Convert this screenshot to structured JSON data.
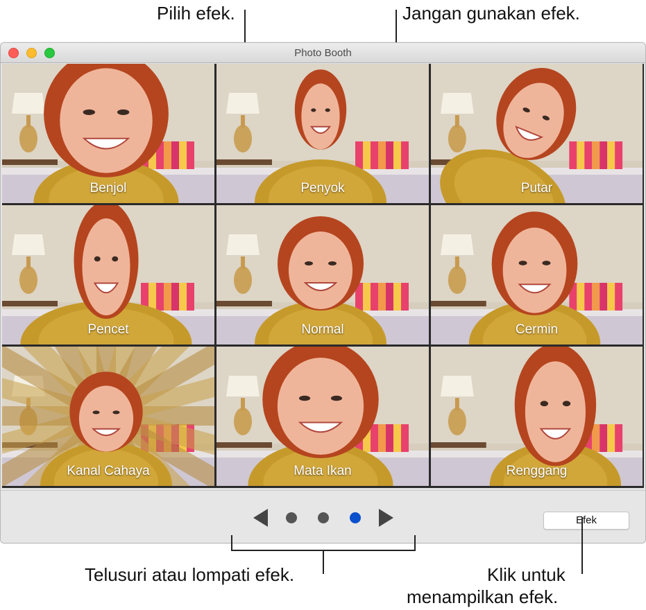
{
  "callouts": {
    "choose_effect": "Pilih efek.",
    "no_effect": "Jangan gunakan efek.",
    "browse": "Telusuri atau lompati efek.",
    "click_line1": "Klik untuk",
    "click_line2": "menampilkan efek."
  },
  "window": {
    "title": "Photo Booth",
    "effects": [
      "Benjol",
      "Penyok",
      "Putar",
      "Pencet",
      "Normal",
      "Cermin",
      "Kanal Cahaya",
      "Mata Ikan",
      "Renggang"
    ],
    "effects_button": "Efek",
    "active_page": 3,
    "page_count": 3
  },
  "colors": {
    "close": "#ff5f57",
    "minimize": "#febc2e",
    "zoom": "#28c840",
    "dot_active": "#0a4fcc",
    "dot_inactive": "#555555"
  }
}
